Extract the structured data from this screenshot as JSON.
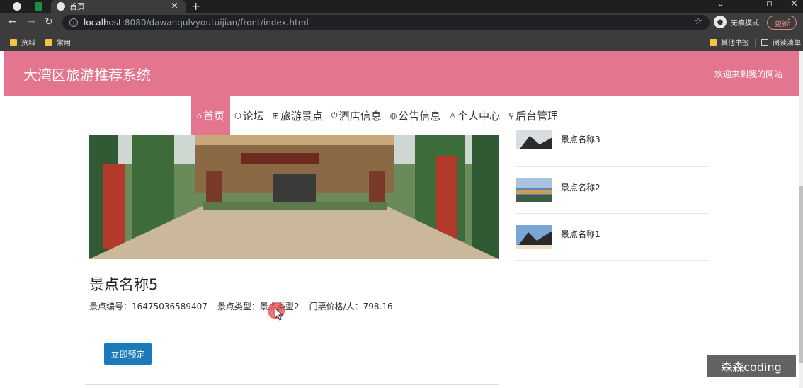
{
  "browser": {
    "tab_title": "首页",
    "url_host": "localhost",
    "url_path": ":8080/dawanqulvyoutuijian/front/index.html",
    "incognito_label": "无痕模式",
    "update_label": "更新",
    "bookmarks": [
      "资料",
      "常用"
    ],
    "bookmarks_right": [
      "其他书签",
      "阅读清单"
    ]
  },
  "site": {
    "title": "大湾区旅游推荐系统",
    "welcome": "欢迎来到我的网站"
  },
  "nav": {
    "items": [
      {
        "icon": "⌂",
        "label": "首页",
        "active": true
      },
      {
        "icon": "⬡",
        "label": "论坛"
      },
      {
        "icon": "⊞",
        "label": "旅游景点"
      },
      {
        "icon": "⏻",
        "label": "酒店信息"
      },
      {
        "icon": "◍",
        "label": "公告信息"
      },
      {
        "icon": "♙",
        "label": "个人中心"
      },
      {
        "icon": "⚲",
        "label": "后台管理"
      }
    ]
  },
  "detail": {
    "name": "景点名称5",
    "id_label": "景点编号：",
    "id_value": "16475036589407",
    "type_label": "景点类型：",
    "type_value": "景点类型2",
    "price_label": "门票价格/人：",
    "price_value": "798.16",
    "book_label": "立即预定"
  },
  "side": {
    "items": [
      {
        "label": "景点名称3"
      },
      {
        "label": "景点名称2"
      },
      {
        "label": "景点名称1"
      }
    ]
  },
  "watermark": "森森coding",
  "colors": {
    "brand": "#e4758f",
    "button": "#1b7bb8"
  }
}
